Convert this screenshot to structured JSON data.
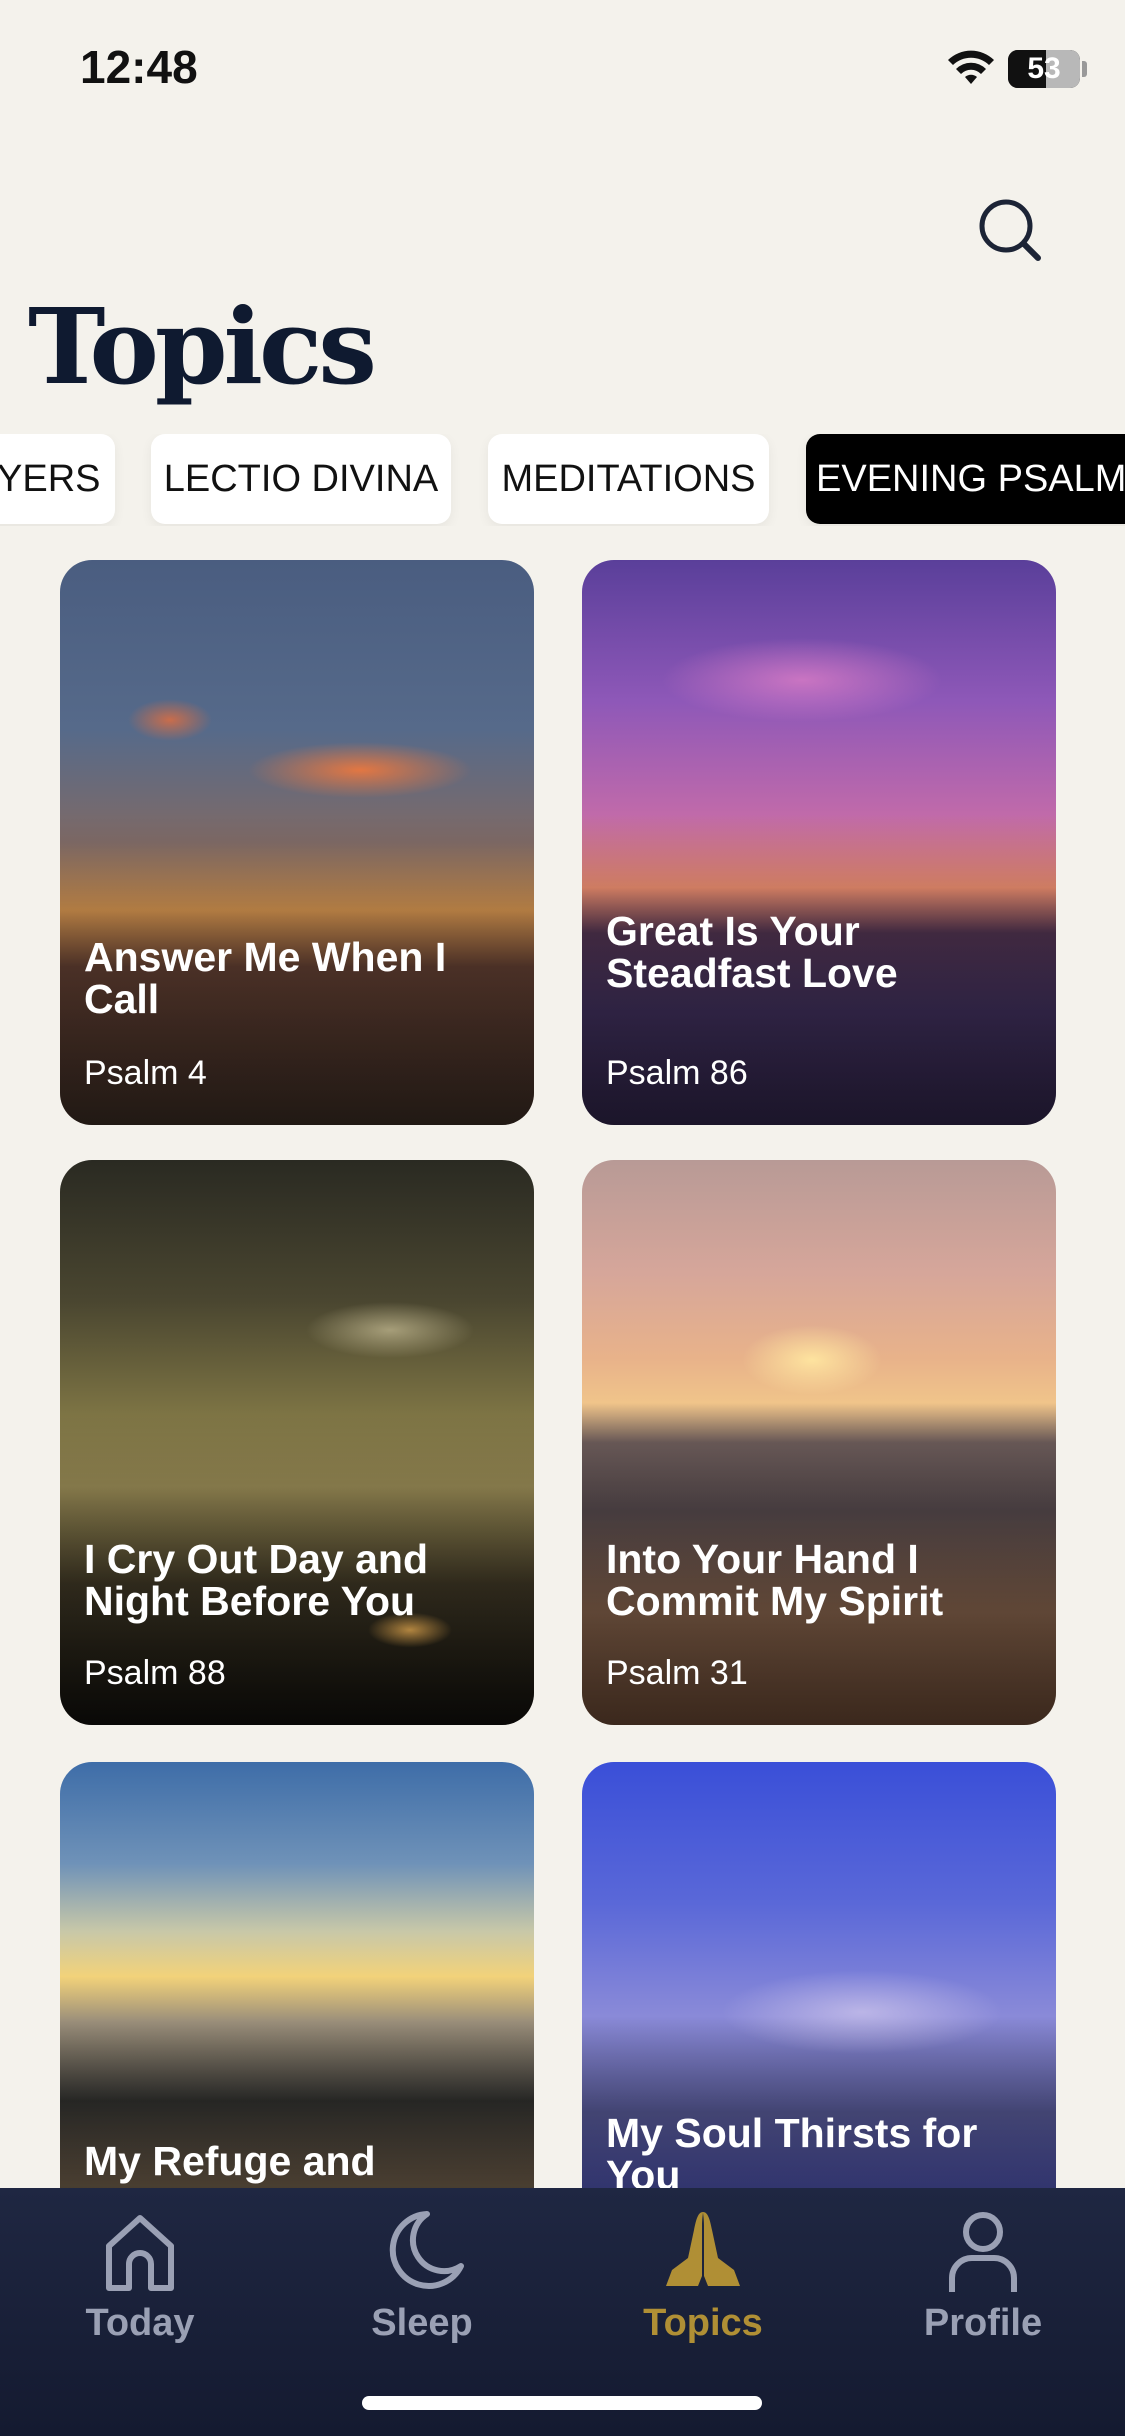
{
  "status_bar": {
    "time": "12:48",
    "battery": "53",
    "battery_level": 0.53
  },
  "header": {
    "title": "Topics",
    "search_icon": "search-icon"
  },
  "chips": [
    {
      "label": "PRAYERS",
      "visible_text": "AYERS",
      "active": false
    },
    {
      "label": "LECTIO DIVINA",
      "active": false
    },
    {
      "label": "MEDITATIONS",
      "active": false
    },
    {
      "label": "EVENING PSALMS",
      "active": true
    }
  ],
  "cards": [
    {
      "title": "Answer Me When I Call",
      "subtitle": "Psalm 4"
    },
    {
      "title": "Great Is Your Steadfast Love",
      "subtitle": "Psalm 86"
    },
    {
      "title": "I Cry Out Day and Night Before You",
      "subtitle": "Psalm 88"
    },
    {
      "title": "Into Your Hand I Commit My Spirit",
      "subtitle": "Psalm 31"
    },
    {
      "title": "My Refuge and",
      "subtitle": ""
    },
    {
      "title": "My Soul Thirsts for You",
      "subtitle": ""
    }
  ],
  "tab_bar": [
    {
      "label": "Today",
      "icon": "home-icon",
      "active": false
    },
    {
      "label": "Sleep",
      "icon": "moon-icon",
      "active": false
    },
    {
      "label": "Topics",
      "icon": "praying-hands-icon",
      "active": true
    },
    {
      "label": "Profile",
      "icon": "person-icon",
      "active": false
    }
  ],
  "colors": {
    "background": "#f4f2ec",
    "title": "#0f1a30",
    "tab_bar": "#1a2038",
    "tab_active": "#b08f35",
    "tab_inactive": "#9aa0b4"
  }
}
